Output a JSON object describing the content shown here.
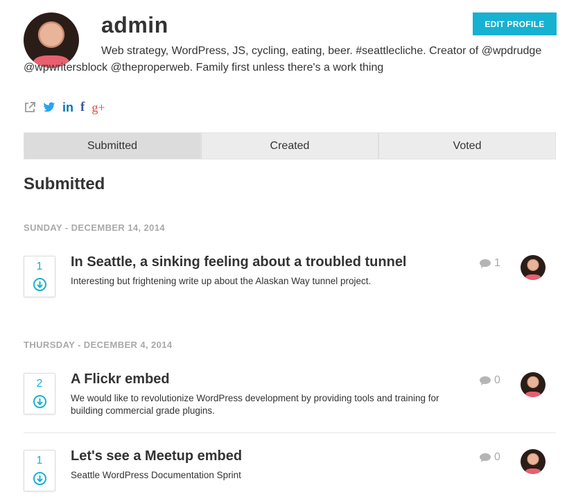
{
  "profile": {
    "name": "admin",
    "edit_button": "EDIT PROFILE",
    "bio": "Web strategy, WordPress, JS, cycling, eating, beer. #seattlecliche. Creator of @wpdrudge @wpwritersblock @theproperweb. Family first unless there's a work thing",
    "socials": [
      {
        "icon": "external-link-icon",
        "glyph": "↗"
      },
      {
        "icon": "twitter-icon"
      },
      {
        "icon": "linkedin-icon",
        "glyph": "in"
      },
      {
        "icon": "facebook-icon",
        "glyph": "f"
      },
      {
        "icon": "google-plus-icon",
        "glyph": "g+"
      }
    ]
  },
  "tabs": [
    {
      "label": "Submitted",
      "active": true
    },
    {
      "label": "Created",
      "active": false
    },
    {
      "label": "Voted",
      "active": false
    }
  ],
  "section_title": "Submitted",
  "groups": [
    {
      "date": "SUNDAY - DECEMBER 14, 2014",
      "items": [
        {
          "votes": "1",
          "title": "In Seattle, a sinking feeling about a troubled tunnel",
          "description": "Interesting but frightening write up about the Alaskan Way tunnel project.",
          "comments": "1"
        }
      ]
    },
    {
      "date": "THURSDAY - DECEMBER 4, 2014",
      "items": [
        {
          "votes": "2",
          "title": "A Flickr embed",
          "description": "We would like to revolutionize WordPress development by providing tools and training for building commercial grade plugins.",
          "comments": "0"
        },
        {
          "votes": "1",
          "title": "Let's see a Meetup embed",
          "description": "Seattle WordPress Documentation Sprint",
          "comments": "0"
        }
      ]
    }
  ],
  "colors": {
    "accent": "#17b1d1",
    "muted": "#a9a9a9",
    "tab_bg": "#ececec",
    "tab_active_bg": "#dcdcdc"
  }
}
